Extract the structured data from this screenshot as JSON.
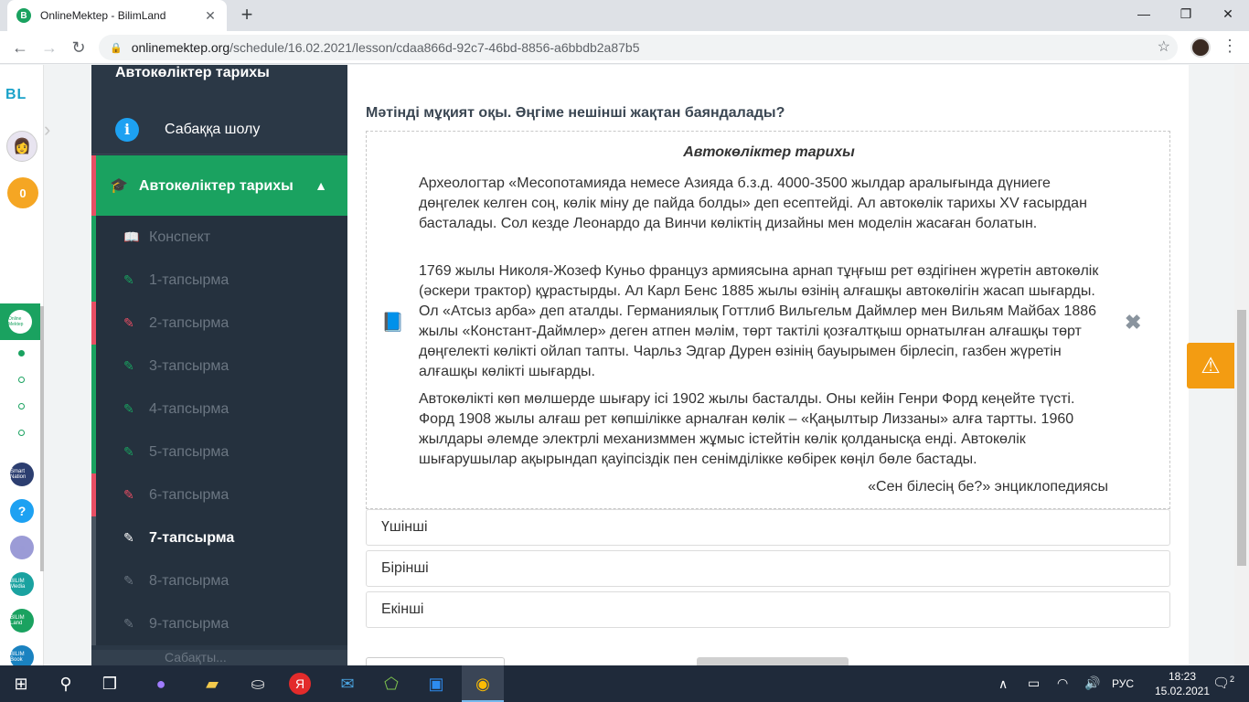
{
  "browser": {
    "tab_title": "OnlineMektep - BilimLand",
    "tab_favicon": "B",
    "url_host": "onlinemektep.org",
    "url_path": "/schedule/16.02.2021/lesson/cdaa866d-92c7-46bd-8856-a6bbdb2a87b5"
  },
  "rail": {
    "logo": "BL",
    "coins": "0",
    "om_label": "Online Mektep",
    "apps": [
      {
        "name": "Smart Nation",
        "color": "#2c3e70"
      },
      {
        "name": "?",
        "color": "#1da1f2"
      },
      {
        "name": "news",
        "color": "#9b9bd6"
      },
      {
        "name": "BILIM Media",
        "color": "#1aa2a0"
      },
      {
        "name": "BILIM Land",
        "color": "#1aa260"
      },
      {
        "name": "BILIM Book",
        "color": "#1a82c0"
      }
    ]
  },
  "course": {
    "title": "Автокөліктер тарихы",
    "overview_label": "Сабаққа шолу",
    "active_label": "Автокөліктер тарихы",
    "items": [
      {
        "label": "Конспект",
        "status": "green",
        "icon": "book-icon"
      },
      {
        "label": "1-тапсырма",
        "status": "green",
        "icon": "edit-icon"
      },
      {
        "label": "2-тапсырма",
        "status": "red",
        "icon": "edit-icon"
      },
      {
        "label": "3-тапсырма",
        "status": "green",
        "icon": "edit-icon"
      },
      {
        "label": "4-тапсырма",
        "status": "green",
        "icon": "edit-icon"
      },
      {
        "label": "5-тапсырма",
        "status": "green",
        "icon": "edit-icon"
      },
      {
        "label": "6-тапсырма",
        "status": "red",
        "icon": "edit-icon"
      },
      {
        "label": "7-тапсырма",
        "status": "current",
        "icon": "edit-icon"
      },
      {
        "label": "8-тапсырма",
        "status": "gray",
        "icon": "edit-icon"
      },
      {
        "label": "9-тапсырма",
        "status": "gray",
        "icon": "edit-icon"
      }
    ],
    "footer": "Сабақты..."
  },
  "task": {
    "question": "Мәтінді мұқият оқы. Әңгіме нешінші жақтан баяндалады?",
    "text_title": "Автокөліктер тарихы",
    "paragraphs": [
      "Археологтар «Месопотамияда немесе Азияда б.з.д. 4000-3500 жылдар аралығында дүниеге дөңгелек келген соң, көлік міну де пайда болды» деп есептейді. Ал автокөлік тарихы XV ғасырдан басталады. Сол кезде Леонардо да Винчи көліктің дизайны мен моделін жасаған болатын.",
      "1769 жылы Николя-Жозеф Куньо француз армиясына арнап тұңғыш рет өздігінен жүретін автокөлік (әскери трактор) құрастырды. Ал Карл Бенс 1885 жылы өзінің алғашқы автокөлігін жасап шығарды. Ол «Атсыз арба» деп аталды. Германиялық Готтлиб Вильгельм Даймлер мен Вильям Майбах 1886 жылы «Констант-Даймлер» деген атпен мәлім, төрт тактілі қозғалтқыш орнатылған алғашқы төрт дөңгелекті көлікті ойлап тапты. Чарльз Эдгар Дурен өзінің бауырымен бірлесіп, газбен жүретін алғашқы көлікті шығарды.",
      "Автокөлікті көп мөлшерде шығару ісі 1902 жылы басталды. Оны кейін Генри Форд кеңейте түсті. Форд 1908 жылы алғаш рет көпшілікке арналған көлік – «Қаңылтыр Лиззаны» алға тартты. 1960 жылдары әлемде электрлі механизммен жұмыс істейтін көлік қолданысқа енді. Автокөлік шығарушылар ақырындап қауіпсіздік пен сенімділікке көбірек көңіл бөле бастады."
    ],
    "source": "«Сен білесің бе?» энциклопедиясы",
    "answers": [
      "Үшінші",
      "Бірінші",
      "Екінші"
    ]
  },
  "taskbar": {
    "lang": "РУС",
    "time": "18:23",
    "date": "15.02.2021",
    "notifications": "2"
  }
}
